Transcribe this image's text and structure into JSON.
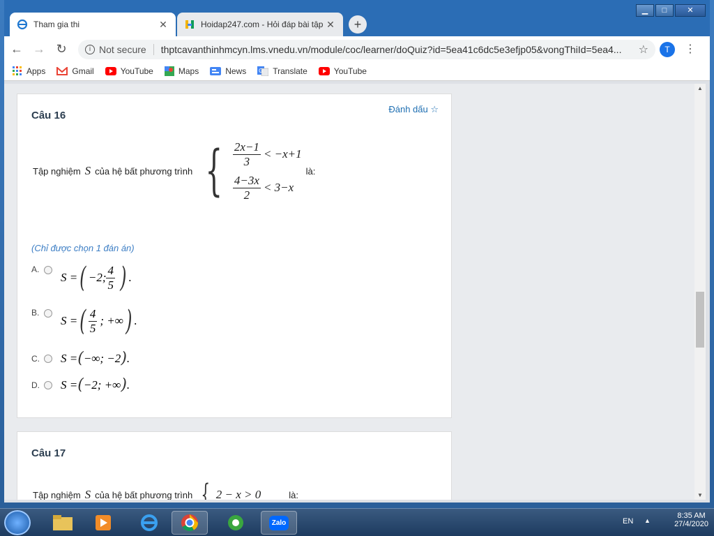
{
  "browser": {
    "tabs": [
      {
        "title": "Tham gia thi",
        "icon": "ie-icon"
      },
      {
        "title": "Hoidap247.com - Hỏi đáp bài tập",
        "icon": "hoidap-icon"
      }
    ],
    "nav": {
      "not_secure": "Not secure",
      "url": "thptcavanthinhmcyn.lms.vnedu.vn/module/coc/learner/doQuiz?id=5ea41c6dc5e3efjp05&vongThiId=5ea4...",
      "profile_initial": "T"
    },
    "bookmarks": [
      "Apps",
      "Gmail",
      "YouTube",
      "Maps",
      "News",
      "Translate",
      "YouTube"
    ]
  },
  "quiz": {
    "q16": {
      "title": "Câu 16",
      "mark_label": "Đánh dấu ☆",
      "stem_prefix": "Tập nghiệm",
      "stem_var": "S",
      "stem_middle": "của hệ bất phương trình",
      "stem_suffix": "là:",
      "eq1": {
        "num": "2x−1",
        "den": "3",
        "rhs": "< −x+1"
      },
      "eq2": {
        "num": "4−3x",
        "den": "2",
        "rhs": "< 3−x"
      },
      "hint": "(Chỉ được chọn 1 đán án)",
      "options": [
        {
          "letter": "A.",
          "lhs": "S =",
          "a": "−2;",
          "fnum": "4",
          "fden": "5",
          "tail": "."
        },
        {
          "letter": "B.",
          "lhs": "S =",
          "fnum": "4",
          "fden": "5",
          "b": "; +∞",
          "tail": "."
        },
        {
          "letter": "C.",
          "lhs": "S =",
          "inner": "−∞; −2",
          "tail": "."
        },
        {
          "letter": "D.",
          "lhs": "S =",
          "inner": "−2; +∞",
          "tail": "."
        }
      ]
    },
    "q17": {
      "title": "Câu 17",
      "stem_prefix": "Tập nghiệm",
      "stem_var": "S",
      "stem_middle": "của hệ bất phương trình",
      "eq1": "2 − x > 0",
      "stem_suffix": "là:"
    }
  },
  "taskbar": {
    "lang": "EN",
    "time": "8:35 AM",
    "date": "27/4/2020",
    "zalo_label": "Zalo"
  }
}
